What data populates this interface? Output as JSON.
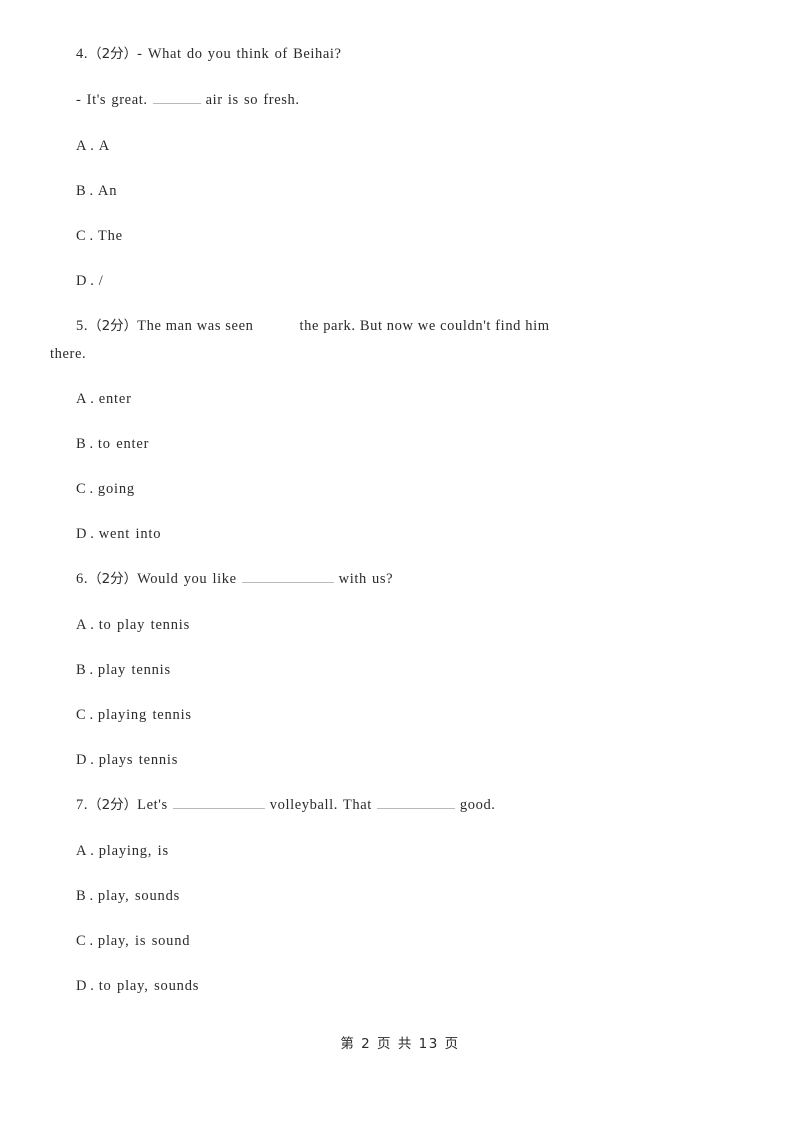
{
  "document": {
    "page_label": "第 2 页 共 13 页",
    "page_number": 2,
    "total_pages": 13,
    "background_color": "#ffffff",
    "text_color": "#2b2b2b",
    "blank_line_color": "#b9b9b9"
  },
  "questions": [
    {
      "number": "4.",
      "score": "（2分）",
      "stem_line1": "- What do you think of Beihai?",
      "stem_line2_pre": "- It's great.",
      "stem_line2_post": "air is so fresh.",
      "options": [
        {
          "letter": "A",
          "dot": ".",
          "text": "A"
        },
        {
          "letter": "B",
          "dot": ".",
          "text": "An"
        },
        {
          "letter": "C",
          "dot": ".",
          "text": "The"
        },
        {
          "letter": "D",
          "dot": ".",
          "text": "/"
        }
      ]
    },
    {
      "number": "5.",
      "score": "（2分）",
      "stem_pre": "The man was seen",
      "stem_post": "the park. But now we couldn't find him",
      "stem_wrap": "there.",
      "options": [
        {
          "letter": "A",
          "dot": ".",
          "text": "enter"
        },
        {
          "letter": "B",
          "dot": ".",
          "text": "to enter"
        },
        {
          "letter": "C",
          "dot": ".",
          "text": "going"
        },
        {
          "letter": "D",
          "dot": ".",
          "text": "went into"
        }
      ]
    },
    {
      "number": "6.",
      "score": "（2分）",
      "stem_pre": "Would you like",
      "stem_post": "with us?",
      "options": [
        {
          "letter": "A",
          "dot": ".",
          "text": "to play tennis"
        },
        {
          "letter": "B",
          "dot": ".",
          "text": "play tennis"
        },
        {
          "letter": "C",
          "dot": ".",
          "text": "playing tennis"
        },
        {
          "letter": "D",
          "dot": ".",
          "text": "plays tennis"
        }
      ]
    },
    {
      "number": "7.",
      "score": "（2分）",
      "stem_pre": "Let's",
      "stem_mid": "volleyball. That",
      "stem_post": "good.",
      "options": [
        {
          "letter": "A",
          "dot": ".",
          "text": "playing, is"
        },
        {
          "letter": "B",
          "dot": ".",
          "text": "play, sounds"
        },
        {
          "letter": "C",
          "dot": ".",
          "text": "play, is sound"
        },
        {
          "letter": "D",
          "dot": ".",
          "text": "to play, sounds"
        }
      ]
    }
  ]
}
